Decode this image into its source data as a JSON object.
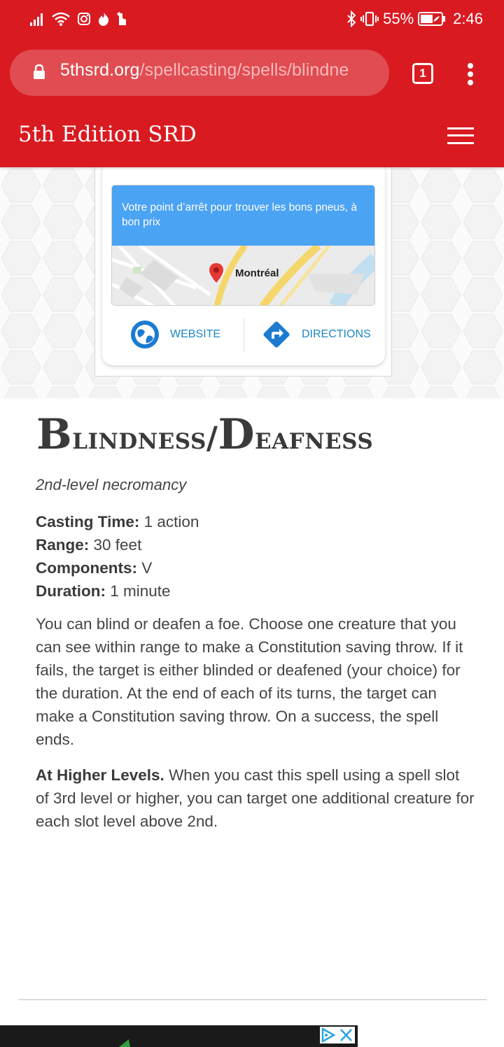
{
  "status_bar": {
    "battery_percent": "55%",
    "time": "2:46"
  },
  "browser": {
    "url_domain": "5thsrd.org",
    "url_path": "/spellcasting/spells/blindne",
    "tab_count": "1"
  },
  "site": {
    "title": "5th Edition SRD"
  },
  "ad": {
    "headline": "Votre point d’arrêt pour trouver les bons pneus, à bon prix",
    "map_label": "Montréal",
    "website_label": "WEBSITE",
    "directions_label": "DIRECTIONS",
    "brand_color": "#4ba3f4",
    "link_color": "#1c86c7"
  },
  "spell": {
    "title": "Blindness/Deafness",
    "school": "2nd-level necromancy",
    "casting_time_label": "Casting Time:",
    "casting_time": " 1 action",
    "range_label": "Range:",
    "range": " 30 feet",
    "components_label": "Components:",
    "components": " V",
    "duration_label": "Duration:",
    "duration": " 1 minute",
    "description": "You can blind or deafen a foe. Choose one creature that you can see within range to make a Constitution saving throw. If it fails, the target is either blinded or deafened (your choice) for the duration. At the end of each of its turns, the target can make a Constitution saving throw. On a success, the spell ends.",
    "higher_levels_label": "At Higher Levels.",
    "higher_levels": " When you cast this spell using a spell slot of 3rd level or higher, you can target one additional creature for each slot level above 2nd."
  },
  "theme": {
    "accent": "#d91b21"
  }
}
